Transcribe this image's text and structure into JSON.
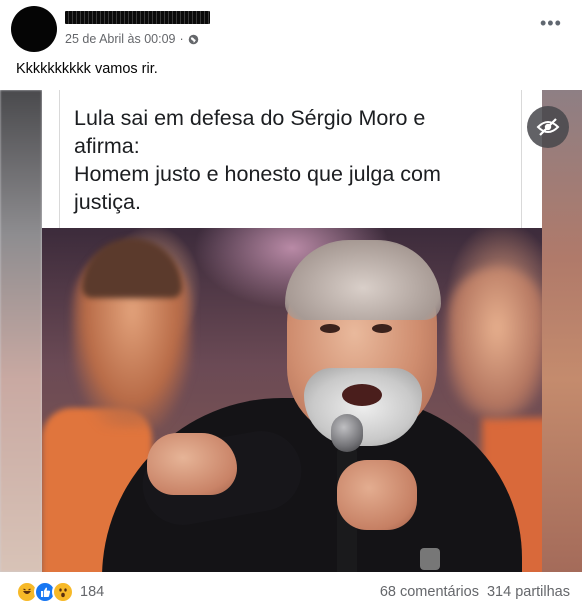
{
  "post": {
    "timestamp": "25 de Abril às 00:09",
    "separator": "·",
    "caption": "Kkkkkkkkkk vamos rir.",
    "more_label": "•••"
  },
  "image_card": {
    "lines": [
      "Lula sai em defesa do Sérgio Moro e",
      "afirma:",
      "Homem justo e honesto que julga com",
      "justiça."
    ],
    "hide_icon": "eye-slash-icon"
  },
  "footer": {
    "reaction_icons": [
      "haha-icon",
      "like-icon",
      "wow-icon"
    ],
    "reaction_count": "184",
    "comments": "68 comentários",
    "shares": "314 partilhas"
  },
  "colors": {
    "meta_text": "#65676b",
    "like_blue": "#1877f2",
    "emoji_yellow": "#f7b928"
  }
}
